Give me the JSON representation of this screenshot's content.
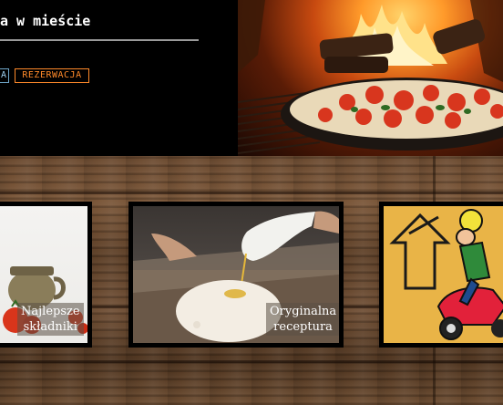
{
  "header": {
    "title": "a w mieście",
    "nav": [
      {
        "label": "A"
      },
      {
        "label": "REZERWACJA"
      }
    ]
  },
  "cards": [
    {
      "caption_line1": "Najlepsze",
      "caption_line2": "składniki",
      "icon": "ingredients-photo"
    },
    {
      "caption_line1": "Oryginalna",
      "caption_line2": "receptura",
      "icon": "dough-photo"
    },
    {
      "icon": "delivery-scooter-illustration"
    }
  ],
  "colors": {
    "accent_orange": "#ff8a2a",
    "nav_blue": "#9fd0f0",
    "header_bg": "#000000"
  }
}
